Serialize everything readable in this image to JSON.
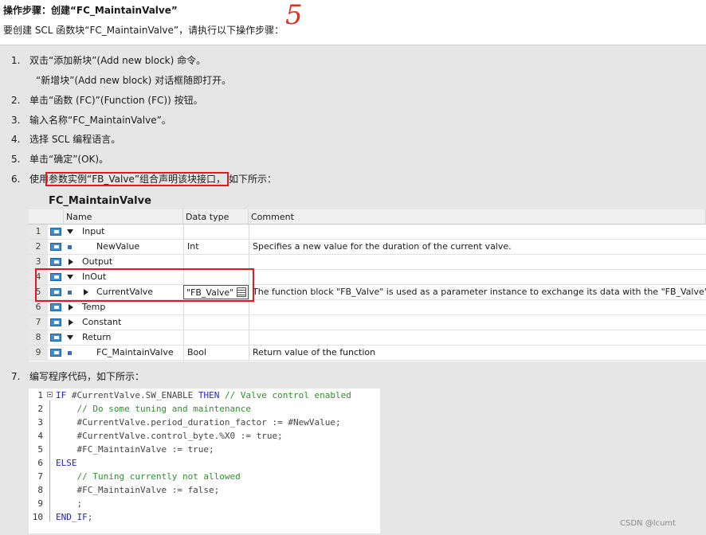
{
  "header": {
    "title": "操作步骤：创建“FC_MaintainValve”",
    "subtitle": "要创建 SCL 函数块“FC_MaintainValve”，请执行以下操作步骤：",
    "annotation": "5"
  },
  "steps": [
    {
      "num": "1.",
      "text": "双击“添加新块”(Add new block) 命令。"
    },
    {
      "num": "",
      "text": "“新增块”(Add new block) 对话框随即打开。"
    },
    {
      "num": "2.",
      "text": "单击“函数 (FC)”(Function (FC)) 按钮。"
    },
    {
      "num": "3.",
      "text": "输入名称“FC_MaintainValve”。"
    },
    {
      "num": "4.",
      "text": "选择 SCL 编程语言。"
    },
    {
      "num": "5.",
      "text": "单击“确定”(OK)。"
    },
    {
      "num": "6.",
      "prefix": "使用",
      "highlight": "参数实例“FB_Valve”组合声明该块接口，",
      "suffix": "如下所示："
    },
    {
      "num": "7.",
      "text": "编写程序代码，如下所示："
    }
  ],
  "interface_table": {
    "title": "FC_MaintainValve",
    "columns": [
      "Name",
      "Data type",
      "Comment"
    ],
    "rows": [
      {
        "num": "1",
        "expander": "open",
        "level": 0,
        "name": "Input",
        "type": "",
        "comment": ""
      },
      {
        "num": "2",
        "expander": "none",
        "level": 1,
        "name": "NewValue",
        "type": "Int",
        "comment": "Specifies a new value for the duration of the current valve."
      },
      {
        "num": "3",
        "expander": "closed",
        "level": 0,
        "name": "Output",
        "type": "",
        "comment": ""
      },
      {
        "num": "4",
        "expander": "open",
        "level": 0,
        "name": "InOut",
        "type": "",
        "comment": ""
      },
      {
        "num": "5",
        "expander": "closed",
        "level": 1,
        "name": "CurrentValve",
        "type": "\"FB_Valve\"",
        "comment": "The function block \"FB_Valve\" is used as a parameter instance to exchange its data with the \"FB_Valve\"."
      },
      {
        "num": "6",
        "expander": "closed",
        "level": 0,
        "name": "Temp",
        "type": "",
        "comment": ""
      },
      {
        "num": "7",
        "expander": "closed",
        "level": 0,
        "name": "Constant",
        "type": "",
        "comment": ""
      },
      {
        "num": "8",
        "expander": "open",
        "level": 0,
        "name": "Return",
        "type": "",
        "comment": ""
      },
      {
        "num": "9",
        "expander": "none",
        "level": 1,
        "name": "FC_MaintainValve",
        "type": "Bool",
        "comment": "Return value of the function"
      }
    ]
  },
  "code": [
    {
      "num": "1",
      "tokens": [
        [
          "kw",
          "IF "
        ],
        [
          "vr",
          "#CurrentValve.SW_ENABLE "
        ],
        [
          "kw",
          "THEN "
        ],
        [
          "cm",
          "// Valve control enabled"
        ]
      ]
    },
    {
      "num": "2",
      "tokens": [
        [
          "cm",
          "    // Do some tuning and maintenance"
        ]
      ]
    },
    {
      "num": "3",
      "tokens": [
        [
          "vr",
          "    #CurrentValve.period_duration_factor := #NewValue;"
        ]
      ]
    },
    {
      "num": "4",
      "tokens": [
        [
          "vr",
          "    #CurrentValve.control_byte.%X0 := true;"
        ]
      ]
    },
    {
      "num": "5",
      "tokens": [
        [
          "vr",
          "    #FC_MaintainValve := true;"
        ]
      ]
    },
    {
      "num": "6",
      "tokens": [
        [
          "kw",
          "ELSE"
        ]
      ]
    },
    {
      "num": "7",
      "tokens": [
        [
          "cm",
          "    // Tuning currently not allowed"
        ]
      ]
    },
    {
      "num": "8",
      "tokens": [
        [
          "vr",
          "    #FC_MaintainValve := false;"
        ]
      ]
    },
    {
      "num": "9",
      "tokens": [
        [
          "vr",
          "    ;"
        ]
      ]
    },
    {
      "num": "10",
      "tokens": [
        [
          "kw",
          "END_IF"
        ],
        [
          "vr",
          ";"
        ]
      ]
    }
  ],
  "footer": "CSDN @lcumt",
  "colors": {
    "accent_red": "#e01b1b",
    "keyword": "#1f1fcc",
    "comment": "#2f8f2f",
    "panel": "#e6e6e6"
  }
}
